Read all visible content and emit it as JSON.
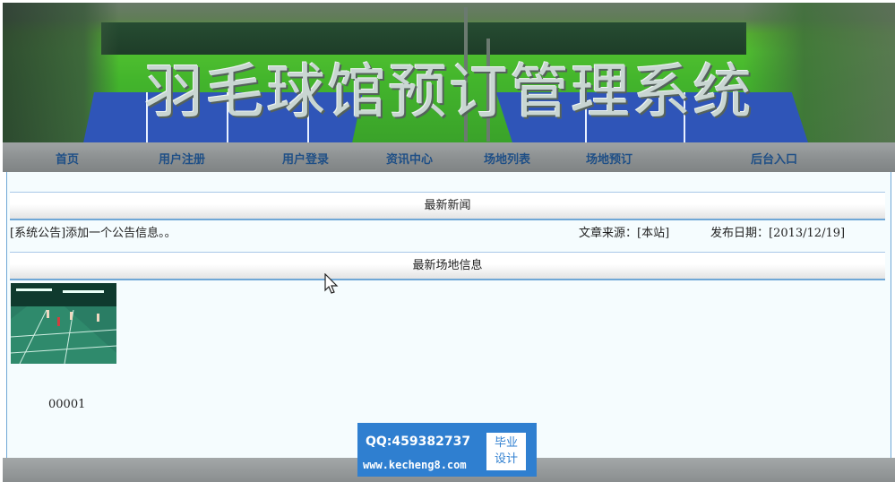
{
  "banner": {
    "title": "羽毛球馆预订管理系统"
  },
  "nav": {
    "items": [
      {
        "label": "首页"
      },
      {
        "label": "用户注册"
      },
      {
        "label": "用户登录"
      },
      {
        "label": "资讯中心"
      },
      {
        "label": "场地列表"
      },
      {
        "label": "场地预订"
      },
      {
        "label": "后台入口"
      }
    ]
  },
  "news_section": {
    "title": "最新新闻",
    "items": [
      {
        "title": "[系统公告]添加一个公告信息。。",
        "source_label": "文章来源：[本站]",
        "date_label": "发布日期：[2013/12/19]"
      }
    ]
  },
  "venue_section": {
    "title": "最新场地信息",
    "items": [
      {
        "name": "00001"
      }
    ]
  },
  "watermark": {
    "qq": "QQ:459382737",
    "site": "www.kecheng8.com",
    "badge_line1": "毕业",
    "badge_line2": "设计"
  },
  "colors": {
    "nav_text": "#1f4f86",
    "accent_border": "#6fa7d6",
    "watermark_bg": "#2f7fd0"
  }
}
